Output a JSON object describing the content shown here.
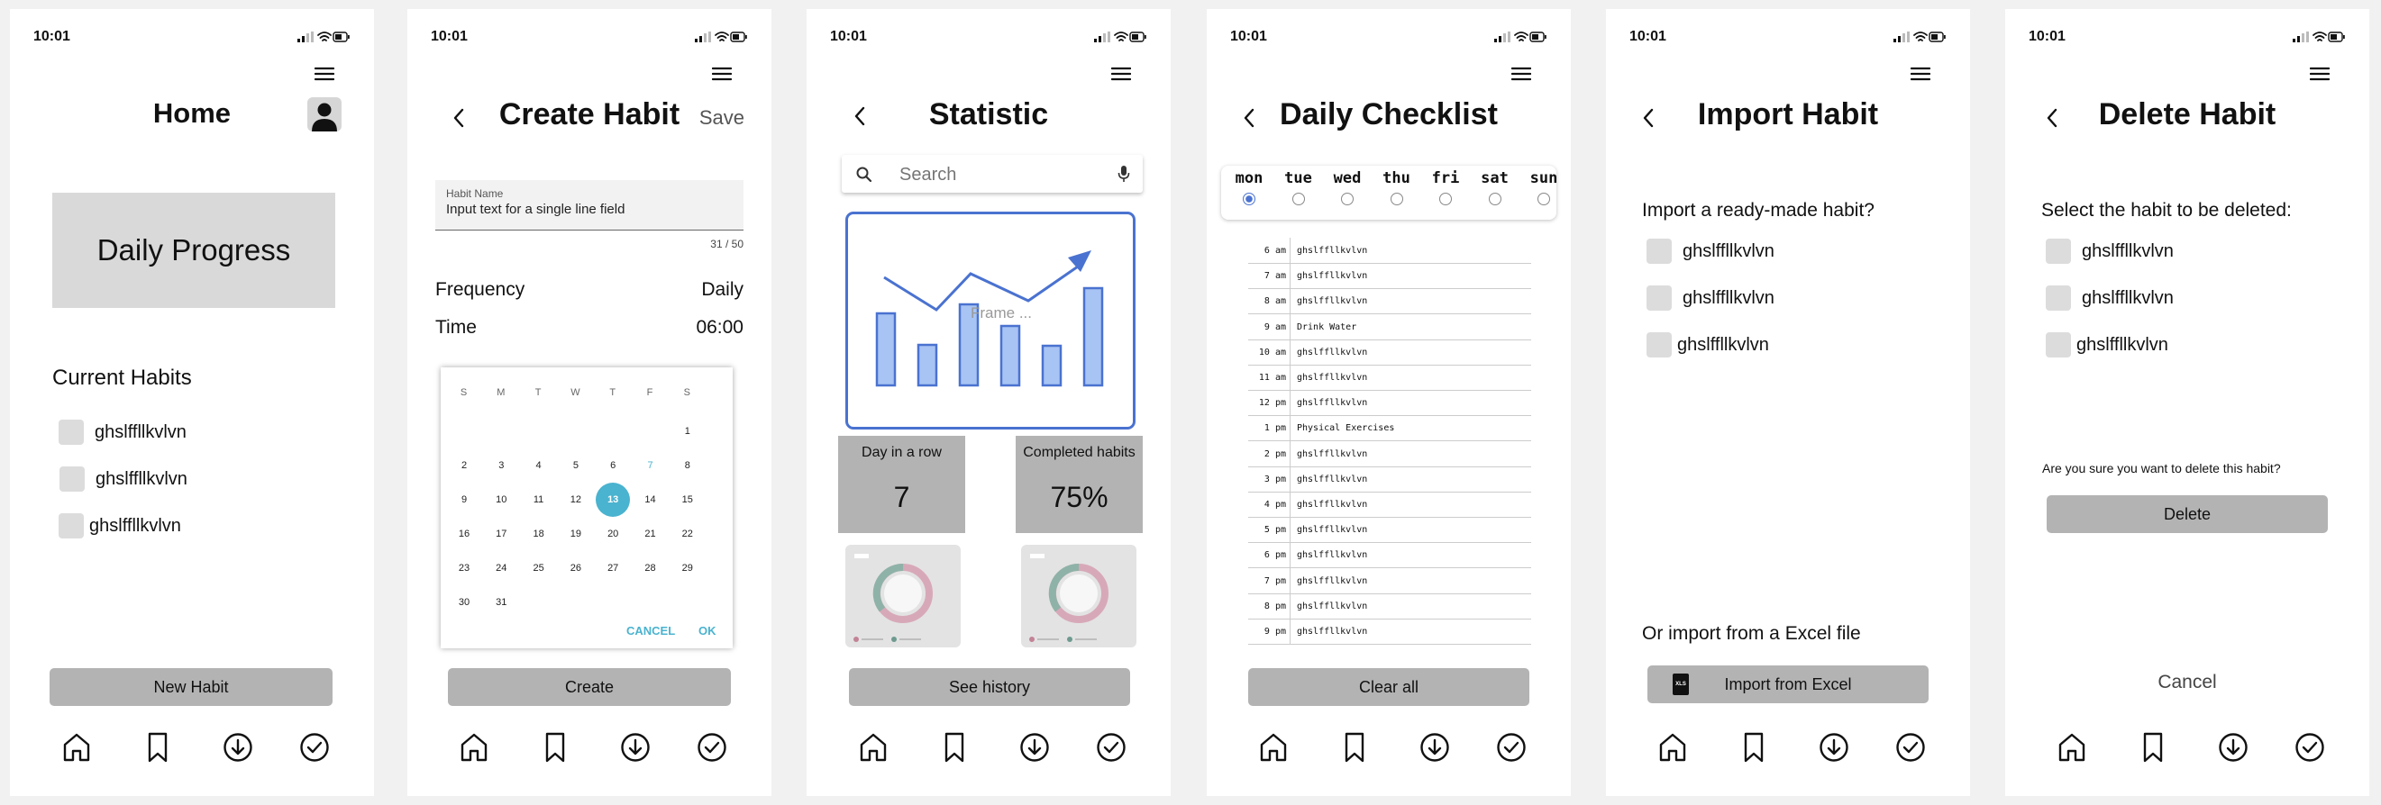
{
  "status_time": "10:01",
  "home": {
    "title": "Home",
    "progress_label": "Daily Progress",
    "current_habits_title": "Current Habits",
    "habits": [
      "ghslffllkvlvn",
      "ghslffllkvlvn",
      "ghslffllkvlvn"
    ],
    "new_habit_button": "New Habit"
  },
  "create": {
    "title": "Create Habit",
    "save": "Save",
    "field_label": "Habit Name",
    "field_value": "Input text for a single line field",
    "counter": "31 / 50",
    "frequency_label": "Frequency",
    "frequency_value": "Daily",
    "time_label": "Time",
    "time_value": "06:00",
    "weekdays": [
      "S",
      "M",
      "T",
      "W",
      "T",
      "F",
      "S"
    ],
    "calendar_rows": [
      [
        "",
        "",
        "",
        "",
        "",
        "",
        "1"
      ],
      [
        "2",
        "3",
        "4",
        "5",
        "6",
        "7",
        "8"
      ],
      [
        "9",
        "10",
        "11",
        "12",
        "13",
        "14",
        "15"
      ],
      [
        "16",
        "17",
        "18",
        "19",
        "20",
        "21",
        "22"
      ],
      [
        "23",
        "24",
        "25",
        "26",
        "27",
        "28",
        "29"
      ],
      [
        "30",
        "31",
        "",
        "",
        "",
        "",
        ""
      ]
    ],
    "selected_day": "13",
    "today": "7",
    "cancel": "CANCEL",
    "ok": "OK",
    "create_button": "Create"
  },
  "statistic": {
    "title": "Statistic",
    "search_placeholder": "Search",
    "frame_label": "Frame ...",
    "day_in_row_label": "Day in a row",
    "day_in_row_value": "7",
    "completed_label": "Completed habits",
    "completed_value": "75%",
    "see_history": "See history"
  },
  "checklist": {
    "title": "Daily Checklist",
    "days": [
      "mon",
      "tue",
      "wed",
      "thu",
      "fri",
      "sat",
      "sun"
    ],
    "selected_day": "mon",
    "rows": [
      {
        "time": "6 am",
        "task": "ghslffllkvlvn"
      },
      {
        "time": "7 am",
        "task": "ghslffllkvlvn"
      },
      {
        "time": "8 am",
        "task": "ghslffllkvlvn"
      },
      {
        "time": "9 am",
        "task": "Drink Water"
      },
      {
        "time": "10 am",
        "task": "ghslffllkvlvn"
      },
      {
        "time": "11 am",
        "task": "ghslffllkvlvn"
      },
      {
        "time": "12 pm",
        "task": "ghslffllkvlvn"
      },
      {
        "time": "1 pm",
        "task": "Physical Exercises"
      },
      {
        "time": "2 pm",
        "task": "ghslffllkvlvn"
      },
      {
        "time": "3 pm",
        "task": "ghslffllkvlvn"
      },
      {
        "time": "4 pm",
        "task": "ghslffllkvlvn"
      },
      {
        "time": "5 pm",
        "task": "ghslffllkvlvn"
      },
      {
        "time": "6 pm",
        "task": "ghslffllkvlvn"
      },
      {
        "time": "7 pm",
        "task": "ghslffllkvlvn"
      },
      {
        "time": "8 pm",
        "task": "ghslffllkvlvn"
      },
      {
        "time": "9 pm",
        "task": "ghslffllkvlvn"
      }
    ],
    "clear_all": "Clear all"
  },
  "import": {
    "title": "Import Habit",
    "question": "Import a ready-made habit?",
    "habits": [
      "ghslffllkvlvn",
      "ghslffllkvlvn",
      "ghslffllkvlvn"
    ],
    "excel_prompt": "Or import from a Excel file",
    "excel_button": "Import from Excel",
    "file_icon_text": "XLS"
  },
  "delete": {
    "title": "Delete Habit",
    "prompt": "Select the habit to be deleted:",
    "habits": [
      "ghslffllkvlvn",
      "ghslffllkvlvn",
      "ghslffllkvlvn"
    ],
    "confirm": "Are you sure you want to delete this habit?",
    "delete_button": "Delete",
    "cancel": "Cancel"
  },
  "colors": {
    "accent_blue": "#4a72d0",
    "calendar_teal": "#4ab3cf",
    "button_grey": "#b3b3b3"
  }
}
